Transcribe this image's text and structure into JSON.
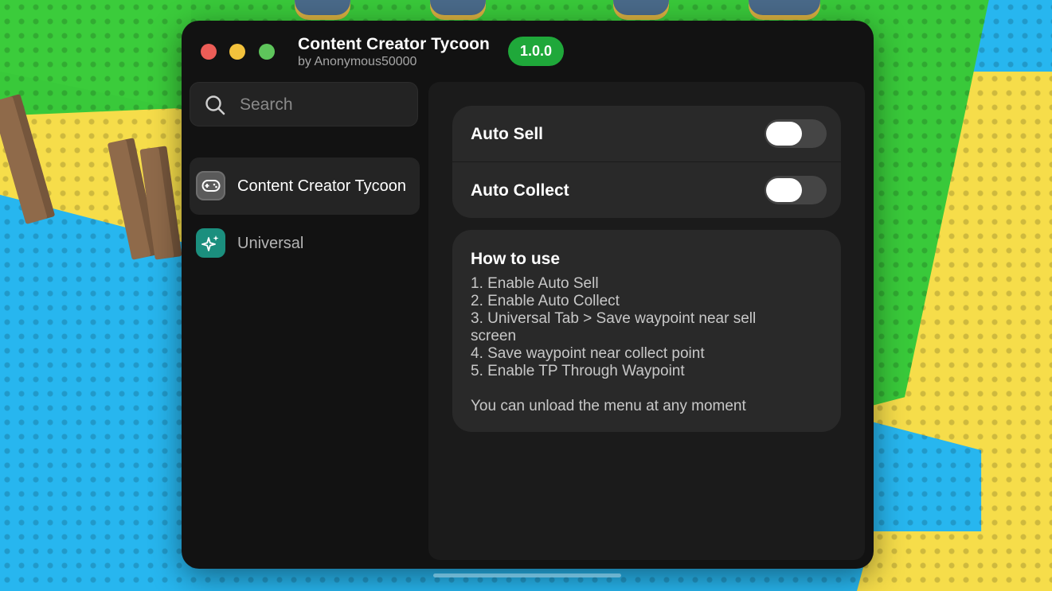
{
  "window": {
    "title": "Content Creator Tycoon",
    "author": "by Anonymous50000",
    "version": "1.0.0"
  },
  "search": {
    "placeholder": "Search",
    "value": ""
  },
  "sidebar": {
    "items": [
      {
        "label": "Content Creator Tycoon",
        "icon": "gamepad-icon",
        "active": true
      },
      {
        "label": "Universal",
        "icon": "sparkles-icon",
        "active": false
      }
    ]
  },
  "toggles": [
    {
      "label": "Auto Sell",
      "enabled": false
    },
    {
      "label": "Auto Collect",
      "enabled": false
    }
  ],
  "howto": {
    "title": "How to use",
    "steps": [
      "1. Enable Auto Sell",
      "2. Enable Auto Collect",
      "3. Universal Tab > Save waypoint near sell screen",
      "4. Save waypoint near collect point",
      "5. Enable TP Through Waypoint"
    ],
    "note": "You can unload the menu at any moment"
  },
  "colors": {
    "window_bg": "#121212",
    "card_bg": "#292929",
    "version_badge": "#1fa83a",
    "traffic_close": "#ec5d57",
    "traffic_minimize": "#f3c23c",
    "traffic_maximize": "#5ec55b",
    "universal_icon_bg": "#1b8f7e"
  }
}
